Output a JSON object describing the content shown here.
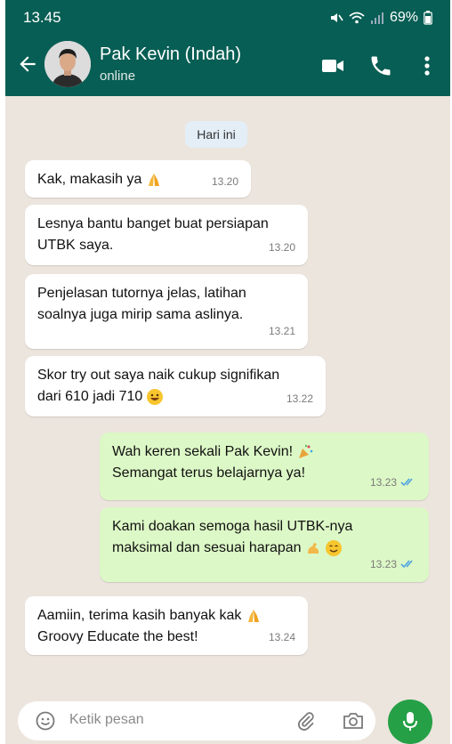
{
  "status_bar": {
    "time": "13.45",
    "battery": "69%"
  },
  "header": {
    "contact_name": "Pak Kevin (Indah)",
    "contact_status": "online"
  },
  "date_chip": "Hari ini",
  "messages": [
    {
      "direction": "in",
      "lines": [
        "Kak, makasih ya"
      ],
      "emoji": "folded-hands",
      "time": "13.20"
    },
    {
      "direction": "in",
      "lines": [
        "Lesnya bantu banget buat persiapan",
        "UTBK saya."
      ],
      "time": "13.20"
    },
    {
      "direction": "in",
      "lines": [
        "Penjelasan tutornya jelas, latihan",
        "soalnya juga mirip sama aslinya."
      ],
      "time": "13.21"
    },
    {
      "direction": "in",
      "lines": [
        "Skor try out saya naik cukup signifikan",
        "dari 610 jadi 710"
      ],
      "emoji": "grinning-face",
      "time": "13.22"
    },
    {
      "direction": "out",
      "lines": [
        "Wah keren sekali Pak Kevin!",
        "Semangat terus belajarnya ya!"
      ],
      "emoji": "party-popper",
      "time": "13.23",
      "read": true
    },
    {
      "direction": "out",
      "lines": [
        "Kami doakan semoga hasil UTBK-nya",
        "maksimal dan sesuai harapan"
      ],
      "emoji": "flexed-biceps smiling-face",
      "time": "13.23",
      "read": true
    },
    {
      "direction": "in",
      "lines": [
        "Aamiin, terima kasih banyak kak",
        "Groovy Educate the best!"
      ],
      "emoji": "folded-hands",
      "time": "13.24"
    }
  ],
  "input": {
    "placeholder": "Ketik pesan"
  },
  "icons": {
    "back": "arrow-left-icon",
    "video": "video-call-icon",
    "call": "phone-icon",
    "menu": "more-vert-icon",
    "emoji": "smiley-icon",
    "attach": "paperclip-icon",
    "camera": "camera-icon",
    "mic": "mic-icon"
  },
  "colors": {
    "header": "#075E54",
    "chat_bg": "#ECE5DD",
    "incoming": "#FFFFFF",
    "outgoing": "#DCF8C6",
    "mic": "#25A046",
    "read_tick": "#4FA3E0"
  }
}
